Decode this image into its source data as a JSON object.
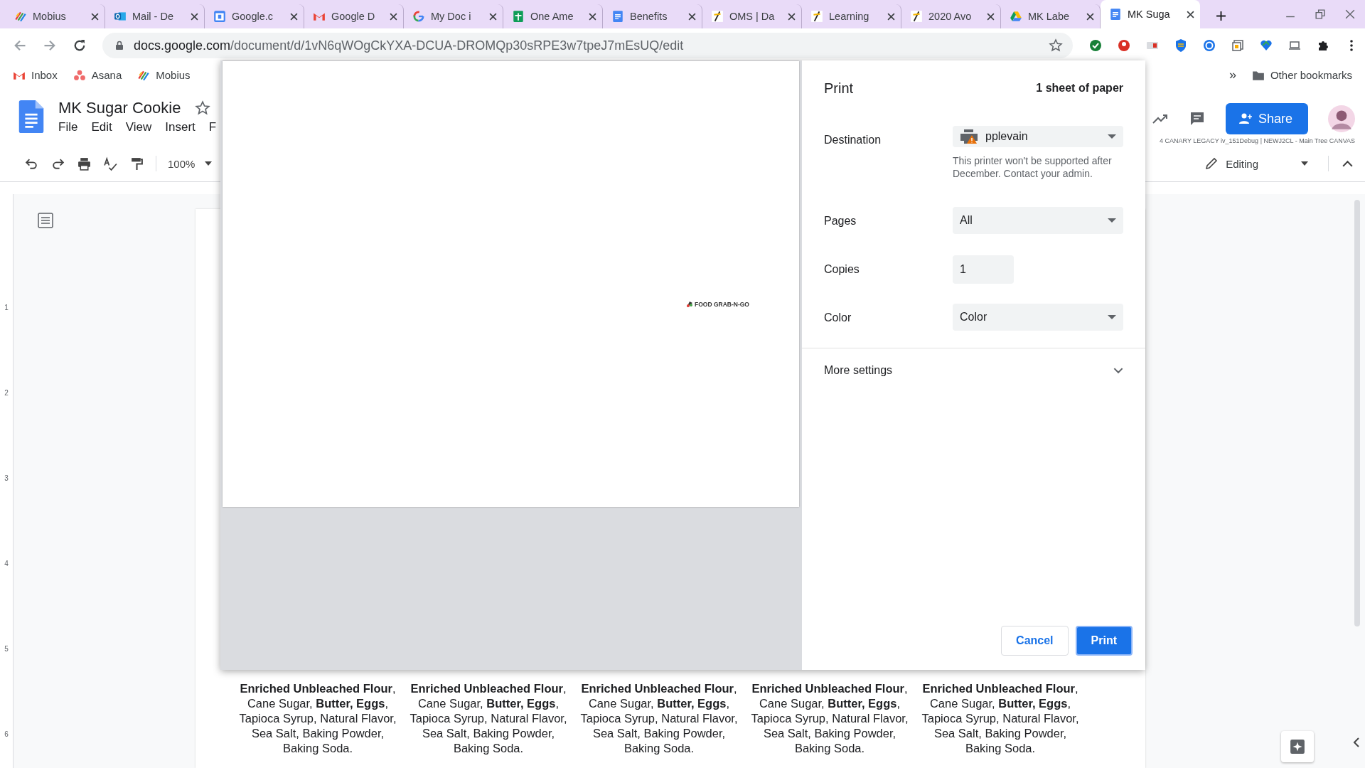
{
  "browser": {
    "tabs": [
      {
        "title": "Mobius",
        "kind": "mobius",
        "selected": false
      },
      {
        "title": "Mail - De",
        "kind": "outlook",
        "selected": false
      },
      {
        "title": "Google.c",
        "kind": "calendar",
        "selected": false
      },
      {
        "title": "Google D",
        "kind": "gmail",
        "selected": false
      },
      {
        "title": "My Doc i",
        "kind": "google",
        "selected": false
      },
      {
        "title": "One Ame",
        "kind": "sheets",
        "selected": false
      },
      {
        "title": "Benefits",
        "kind": "docs",
        "selected": false
      },
      {
        "title": "OMS | Da",
        "kind": "oms",
        "selected": false
      },
      {
        "title": "Learning",
        "kind": "oms",
        "selected": false
      },
      {
        "title": "2020 Avo",
        "kind": "oms",
        "selected": false
      },
      {
        "title": "MK Labe",
        "kind": "drive",
        "selected": false
      },
      {
        "title": "MK Suga",
        "kind": "docs",
        "selected": true
      }
    ],
    "address": {
      "domain": "docs.google.com",
      "path": "/document/d/1vN6qWOgCkYXA-DCUA-DROMQp30sRPE3w7tpeJ7mEsUQ/edit"
    },
    "bookmarks": [
      {
        "label": "Inbox",
        "kind": "gmail"
      },
      {
        "label": "Asana",
        "kind": "asana"
      },
      {
        "label": "Mobius",
        "kind": "mobius"
      }
    ],
    "bookmarks_overflow": "»",
    "other_bookmarks": "Other bookmarks"
  },
  "doc": {
    "title": "MK Sugar Cookie",
    "menu": [
      "File",
      "Edit",
      "View",
      "Insert",
      "F"
    ],
    "share": "Share",
    "debug_label": "4 CANARY LEGACY iv_151Debug | NEWJ2CL - Main Tree CANVAS",
    "zoom": "100%",
    "mode": "Editing",
    "ruler_numbers": [
      "1",
      "2",
      "3",
      "4",
      "5",
      "6"
    ],
    "labels": [
      "**Enriched Unbleached Flour**, Cane Sugar, **Butter, Eggs**, Tapioca Syrup, Natural Flavor, Sea Salt, Baking Powder, Baking Soda.",
      "**Enriched Unbleached Flour**, Cane Sugar, **Butter, Eggs**, Tapioca Syrup, Natural Flavor, Sea Salt, Baking Powder, Baking Soda.",
      "**Enriched Unbleached Flour**, Cane Sugar, **Butter, Eggs**, Tapioca Syrup, Natural Flavor, Sea Salt, Baking Powder, Baking Soda.",
      "**Enriched Unbleached Flour**, Cane Sugar, **Butter, Eggs**, Tapioca Syrup, Natural Flavor, Sea Salt, Baking Powder, Baking Soda.",
      "**Enriched Unbleached Flour**, Cane Sugar, **Butter, Eggs**, Tapioca Syrup, Natural Flavor, Sea Salt, Baking Powder, Baking Soda."
    ]
  },
  "print_dialog": {
    "title": "Print",
    "sheets": "1 sheet of paper",
    "preview_logo": "FOOD GRAB-N-GO",
    "settings": [
      {
        "kind": "printer",
        "label": "Destination",
        "value": "pplevain",
        "warning": "This printer won't be supported after December. Contact your admin."
      },
      {
        "kind": "select",
        "label": "Pages",
        "value": "All"
      },
      {
        "kind": "input",
        "label": "Copies",
        "value": "1"
      },
      {
        "kind": "select",
        "label": "Color",
        "value": "Color"
      }
    ],
    "more_settings": {
      "label": "More settings",
      "expanded": false
    },
    "buttons": [
      {
        "label": "Cancel",
        "kind": "secondary"
      },
      {
        "label": "Print",
        "kind": "primary"
      }
    ]
  }
}
